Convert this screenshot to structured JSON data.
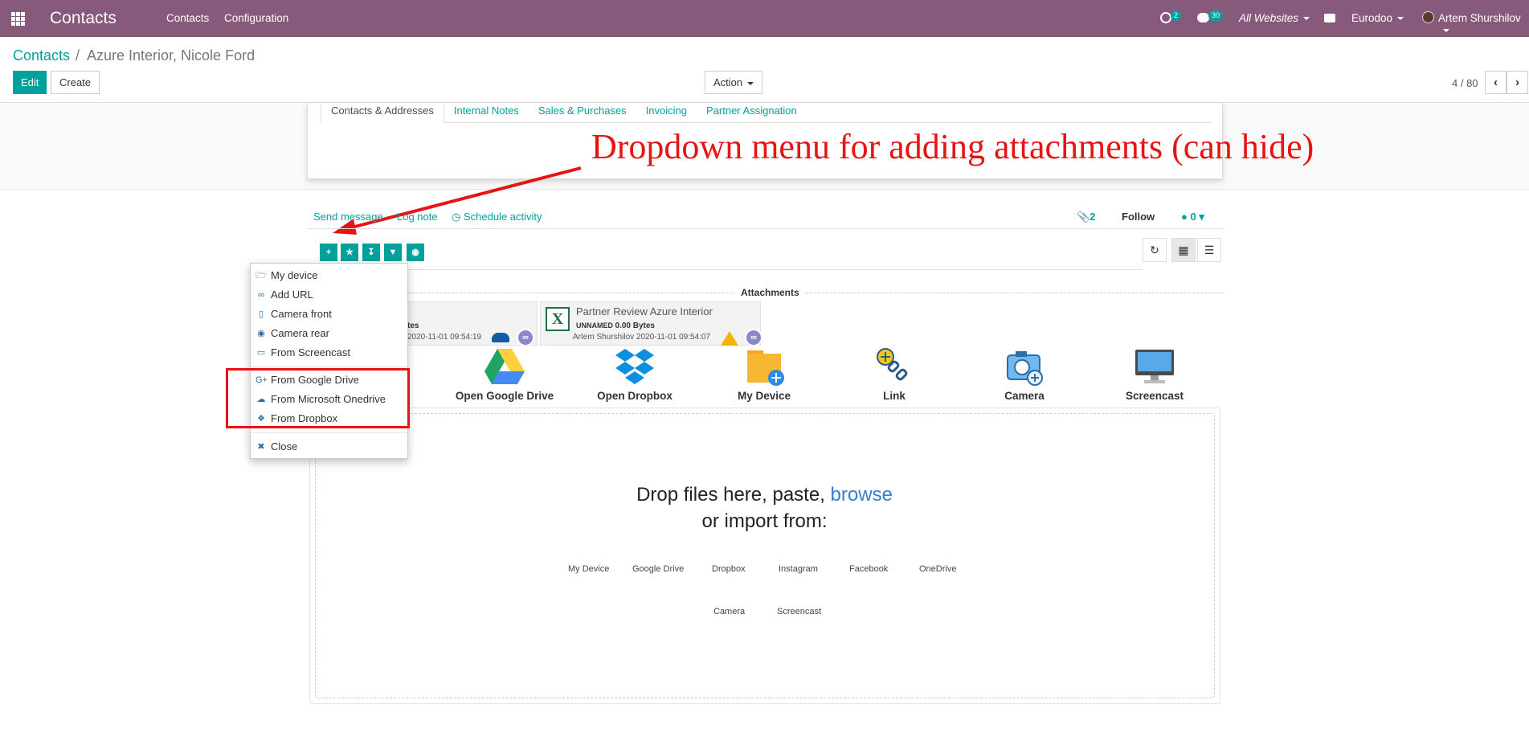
{
  "topbar": {
    "app_title": "Contacts",
    "nav": [
      "Contacts",
      "Configuration"
    ],
    "activity_badge": "2",
    "messages_badge": "30",
    "websites": "All Websites",
    "company": "Eurodoo",
    "user": "Artem Shurshilov"
  },
  "control_panel": {
    "breadcrumb_parent": "Contacts",
    "breadcrumb_sep": "/",
    "breadcrumb_current": "Azure Interior, Nicole Ford",
    "edit_label": "Edit",
    "create_label": "Create",
    "action_label": "Action",
    "pager": "4 / 80",
    "prev_icon": "chevron-left-icon",
    "next_icon": "chevron-right-icon"
  },
  "form": {
    "tabs": [
      "Contacts & Addresses",
      "Internal Notes",
      "Sales & Purchases",
      "Invoicing",
      "Partner Assignation"
    ]
  },
  "annotation": {
    "text": "Dropdown menu for adding attachments (can hide)",
    "color": "#e81313"
  },
  "chatter": {
    "send_message": "Send message",
    "log_note": "Log note",
    "schedule_activity": "Schedule activity",
    "attachment_count": "2",
    "follow": "Follow",
    "followers": "0"
  },
  "toolbar": {
    "buttons": [
      "plus-icon",
      "star-icon",
      "download-icon",
      "filter-icon",
      "camera-icon"
    ],
    "view_buttons": [
      "refresh-icon",
      "grid-icon",
      "list-icon"
    ]
  },
  "attachments": {
    "title": "Attachments",
    "cards": [
      {
        "name_partial": "tes",
        "meta_partial": "2020-11-01 09:54:19"
      },
      {
        "name": "Partner Review Azure Interior",
        "size_label": "UNNAMED",
        "size": "0.00 Bytes",
        "meta": "Artem Shurshilov 2020-11-01 09:54:07"
      }
    ]
  },
  "import_sources": [
    "Open Google Drive",
    "Open Dropbox",
    "My Device",
    "Link",
    "Camera",
    "Screencast"
  ],
  "dropzone": {
    "line1_prefix": "Drop files here, paste,",
    "browse": "browse",
    "line2": "or import from:",
    "sources_row1": [
      "My Device",
      "Google Drive",
      "Dropbox",
      "Instagram",
      "Facebook",
      "OneDrive"
    ],
    "sources_row2": [
      "Camera",
      "Screencast"
    ]
  },
  "dropdown": {
    "items": [
      {
        "label": "My device",
        "icon": "folder-open-icon"
      },
      {
        "label": "Add URL",
        "icon": "link-icon"
      },
      {
        "label": "Camera front",
        "icon": "mobile-icon"
      },
      {
        "label": "Camera rear",
        "icon": "camera-icon"
      },
      {
        "label": "From Screencast",
        "icon": "desktop-icon"
      },
      {
        "label": "From Google Drive",
        "icon": "google-plus-icon"
      },
      {
        "label": "From Microsoft Onedrive",
        "icon": "cloud-icon"
      },
      {
        "label": "From Dropbox",
        "icon": "dropbox-icon"
      },
      {
        "label": "Close",
        "icon": "close-icon"
      }
    ]
  }
}
